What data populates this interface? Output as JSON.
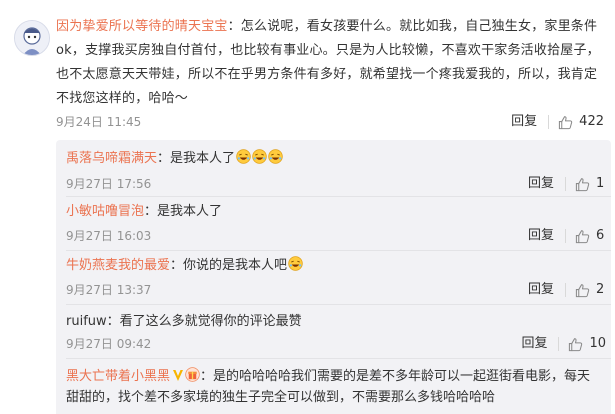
{
  "main_comment": {
    "author": "因为挚爱所以等待的晴天宝宝",
    "text": "：怎么说呢，看女孩要什么。就比如我，自己独生女，家里条件ok，支撑我买房独自付首付，也比较有事业心。只是为人比较懒，不喜欢干家务活收拾屋子，也不太愿意天天带娃，所以不在乎男方条件有多好，就希望找一个疼我爱我的，所以，我肯定不找您这样的，哈哈～",
    "time": "9月24日 11:45",
    "reply_label": "回复",
    "like_count": "422"
  },
  "replies": [
    {
      "author": "禹落乌啼霜满天",
      "text": "：是我本人了",
      "emoji_count": 3,
      "time": "9月27日 17:56",
      "reply_label": "回复",
      "like_count": "1"
    },
    {
      "author": "小敏咕噜冒泡",
      "text": "：是我本人了",
      "emoji_count": 0,
      "time": "9月27日 16:03",
      "reply_label": "回复",
      "like_count": "6"
    },
    {
      "author": "牛奶燕麦我的最爱",
      "text": "：你说的是我本人吧",
      "emoji_count": 1,
      "time": "9月27日 13:37",
      "reply_label": "回复",
      "like_count": "2"
    },
    {
      "author": "ruifuw",
      "text": "：看了这么多就觉得你的评论最赞",
      "emoji_count": 0,
      "time": "9月27日 09:42",
      "reply_label": "回复",
      "like_count": "10"
    },
    {
      "author": "黑大亡带着小黑黑",
      "text": "：是的哈哈哈哈我们需要的是差不多年龄可以一起逛街看电影，每天甜甜的，找个差不多家境的独生子完全可以做到，不需要那么多钱哈哈哈哈",
      "emoji_count": 0,
      "time": "",
      "reply_label": "",
      "like_count": ""
    }
  ],
  "colors": {
    "author": "#eb7350",
    "text": "#333333",
    "meta": "#939393",
    "reply_bg": "#f2f2f5"
  },
  "icons": {
    "like": "thumbs-up-icon",
    "emoji": "laughing-face-icon",
    "vip": "vip-badge-icon"
  }
}
